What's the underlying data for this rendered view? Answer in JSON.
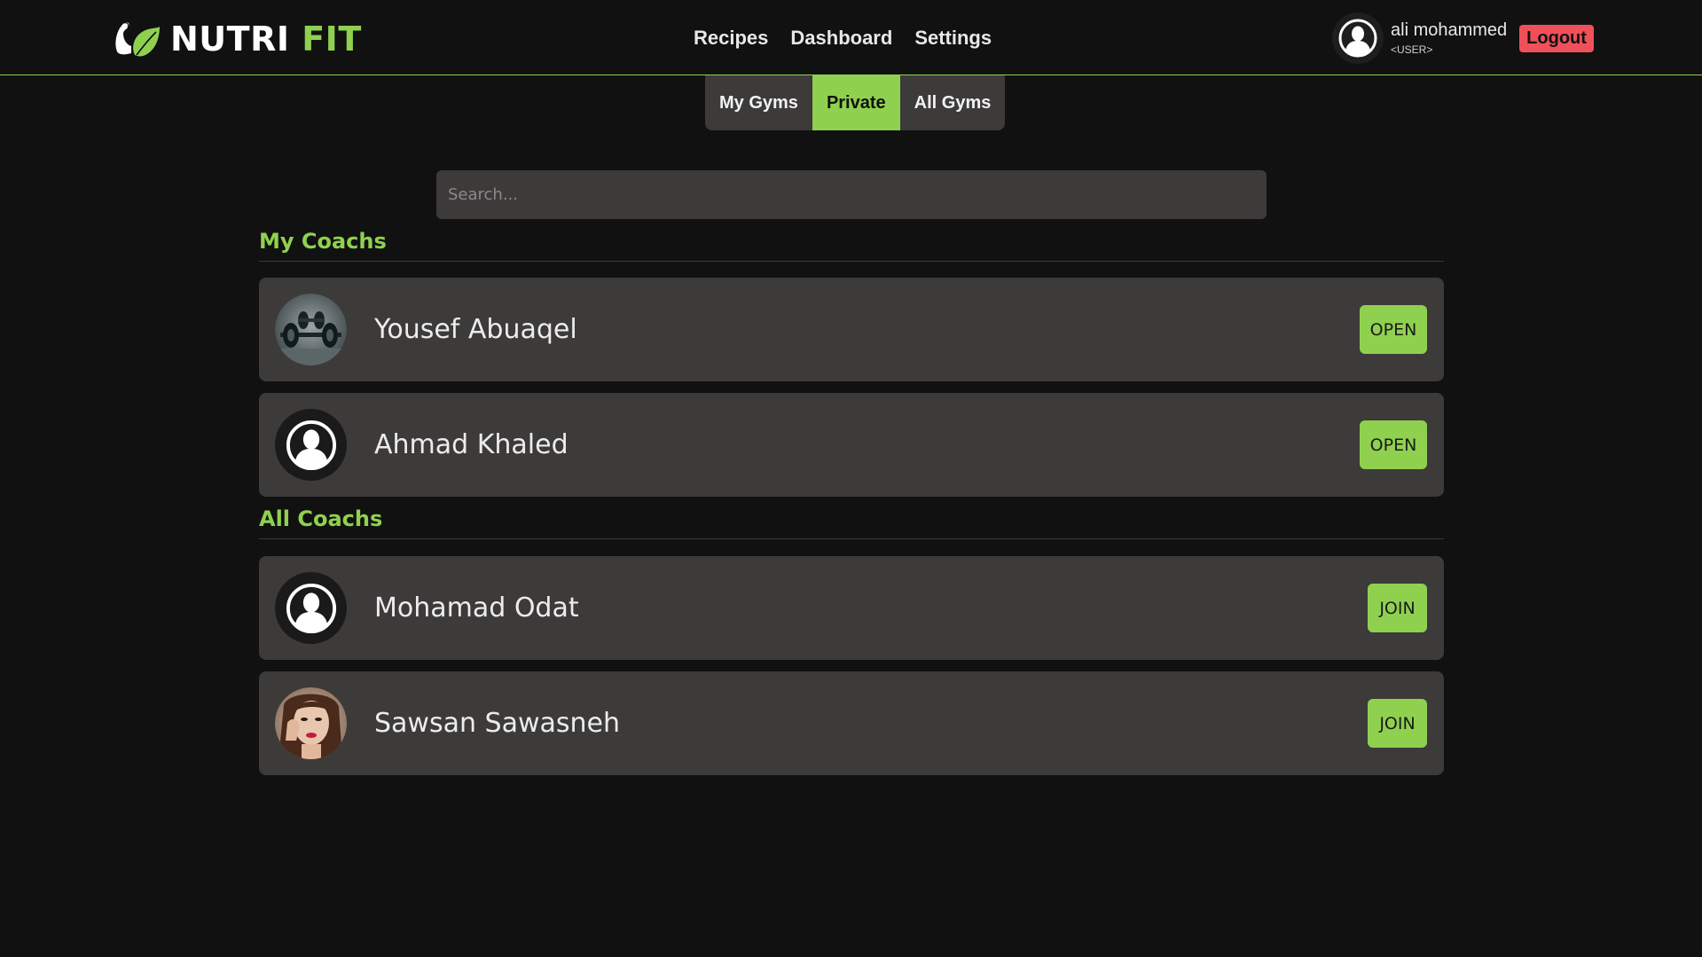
{
  "header": {
    "logo": {
      "word1": "NUTRI",
      "word2": "FIT"
    },
    "nav": [
      "Recipes",
      "Dashboard",
      "Settings"
    ],
    "user": {
      "name": "ali mohammed",
      "role": "<USER>"
    },
    "logout_label": "Logout"
  },
  "tabs": [
    {
      "label": "My Gyms",
      "active": false
    },
    {
      "label": "Private",
      "active": true
    },
    {
      "label": "All Gyms",
      "active": false
    }
  ],
  "search": {
    "placeholder": "Search...",
    "value": ""
  },
  "my_coachs": {
    "title": "My Coachs",
    "items": [
      {
        "name": "Yousef Abuaqel",
        "action": "OPEN",
        "avatar": "dumbbells-photo"
      },
      {
        "name": "Ahmad Khaled",
        "action": "OPEN",
        "avatar": "default-user-icon"
      }
    ]
  },
  "all_coachs": {
    "title": "All Coachs",
    "items": [
      {
        "name": "Mohamad Odat",
        "action": "JOIN",
        "avatar": "default-user-icon"
      },
      {
        "name": "Sawsan Sawasneh",
        "action": "JOIN",
        "avatar": "woman-portrait-photo"
      }
    ]
  },
  "colors": {
    "background": "#111111",
    "accent": "#8fd14f",
    "card": "#3d3a3a",
    "logout": "#f0505a"
  }
}
